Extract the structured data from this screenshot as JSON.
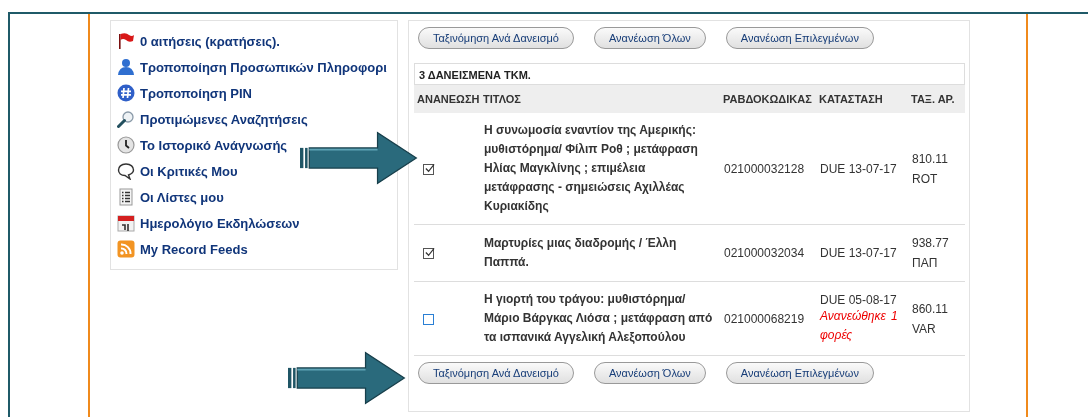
{
  "sidebar": {
    "items": [
      {
        "label": "0 αιτήσεις (κρατήσεις)."
      },
      {
        "label": "Τροποποίηση Προσωπικών Πληροφορι"
      },
      {
        "label": "Τροποποίηση PIN"
      },
      {
        "label": "Προτιμώμενες Αναζητήσεις"
      },
      {
        "label": "Το Ιστορικό Ανάγνωσής"
      },
      {
        "label": "Οι Κριτικές Μου"
      },
      {
        "label": "Οι Λίστες μου"
      },
      {
        "label": "Ημερολόγιο Εκδηλώσεων"
      },
      {
        "label": "My Record Feeds"
      }
    ]
  },
  "top_buttons": [
    "Ταξινόμηση Ανά Δανεισμό",
    "Ανανέωση Όλων",
    "Ανανέωση Επιλεγμένων"
  ],
  "table": {
    "caption": "3 ΔΑΝΕΙΣΜΕΝΑ ΤΚΜ.",
    "columns": [
      "ΑΝΑΝΕΩΣΗ",
      "ΤΙΤΛΟΣ",
      "ΡΑΒΔΟΚΩΔΙΚΑΣ",
      "ΚΑΤΑΣΤΑΣΗ",
      "ΤΑΞ. ΑΡ."
    ],
    "rows": [
      {
        "checked": true,
        "title": "Η συνωμοσία εναντίον της Αμερικής: μυθιστόρημα/ Φίλιπ Ροθ ; μετάφραση Ηλίας Μαγκλίνης ; επιμέλεια μετάφρασης - σημειώσεις Αχιλλέας Κυριακίδης",
        "barcode": "021000032128",
        "status": "DUE 13-07-17",
        "call_number": [
          "810.11",
          "ROT"
        ]
      },
      {
        "checked": true,
        "title": "Μαρτυρίες μιας διαδρομής / Έλλη Παππά.",
        "barcode": "021000032034",
        "status": "DUE 13-07-17",
        "call_number": [
          "938.77",
          "ΠΑΠ"
        ]
      },
      {
        "checked": false,
        "title": "Η γιορτή του τράγου: μυθιστόρημα/ Μάριο Βάργκας Λιόσα ; μετάφραση από τα ισπανικά Αγγελική Αλεξοπούλου",
        "barcode": "021000068219",
        "status": "DUE 05-08-17",
        "renewed_note": "Ανανεώθηκε  1 φορές",
        "call_number": [
          "860.11",
          "VAR"
        ]
      }
    ]
  },
  "bottom_buttons": [
    "Ταξινόμηση Ανά Δανεισμό",
    "Ανανέωση Όλων",
    "Ανανέωση Επιλεγμένων"
  ]
}
